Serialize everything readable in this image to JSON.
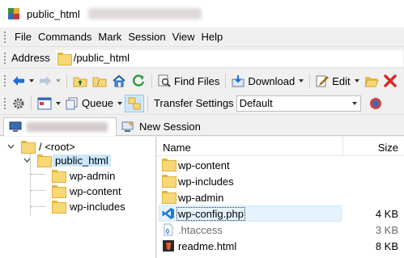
{
  "window": {
    "title": "public_html"
  },
  "menu": [
    "File",
    "Commands",
    "Mark",
    "Session",
    "View",
    "Help"
  ],
  "address": {
    "label": "Address",
    "path": "/public_html"
  },
  "toolbar1": {
    "find_files": "Find Files",
    "download": "Download",
    "edit": "Edit"
  },
  "toolbar2": {
    "queue": "Queue",
    "transfer_settings_label": "Transfer Settings",
    "transfer_settings_value": "Default"
  },
  "tabs": {
    "new_session": "New Session"
  },
  "tree": {
    "root": "/ <root>",
    "public_html": "public_html",
    "children": [
      "wp-admin",
      "wp-content",
      "wp-includes"
    ]
  },
  "files": {
    "columns": {
      "name": "Name",
      "size": "Size"
    },
    "rows": [
      {
        "name": "wp-content",
        "size": "",
        "icon": "folder-icon"
      },
      {
        "name": "wp-includes",
        "size": "",
        "icon": "folder-icon"
      },
      {
        "name": "wp-admin",
        "size": "",
        "icon": "folder-icon"
      },
      {
        "name": "wp-config.php",
        "size": "4 KB",
        "icon": "vscode-icon"
      },
      {
        "name": ".htaccess",
        "size": "3 KB",
        "icon": "file-icon"
      },
      {
        "name": "readme.html",
        "size": "8 KB",
        "icon": "html-icon"
      }
    ]
  },
  "colors": {
    "selection": "#cce8ff",
    "hover": "#e5f3ff",
    "folder": "#f8d775",
    "refresh": "#2e9e3e",
    "delete": "#d92b2b",
    "nav_arrow": "#1d6fd6"
  }
}
